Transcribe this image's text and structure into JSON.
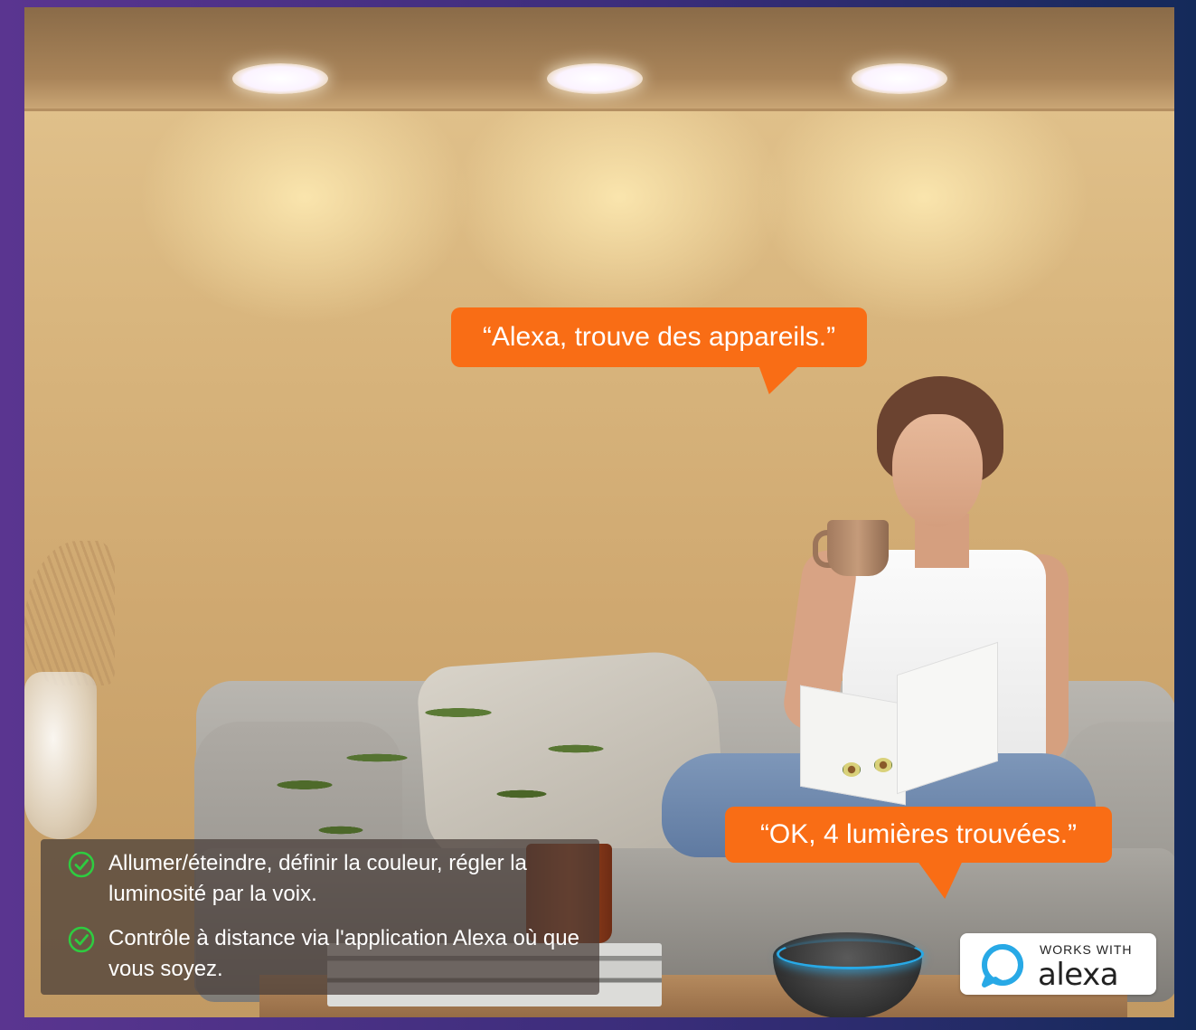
{
  "speech": {
    "request": "“Alexa, trouve des appareils.”",
    "response": "“OK, 4 lumières trouvées.”"
  },
  "features": [
    {
      "icon": "check-circle-icon",
      "text": "Allumer/éteindre, définir la couleur, régler la luminosité par la voix."
    },
    {
      "icon": "check-circle-icon",
      "text": "Contrôle à distance via l'application Alexa où que vous soyez."
    }
  ],
  "badge": {
    "line1": "WORKS WITH",
    "line2": "alexa",
    "icon": "alexa-ring-icon"
  },
  "colors": {
    "bubble": "#f96d15",
    "check": "#2ecc40",
    "alexa_blue": "#28a9e6",
    "frame_left": "#5a3590",
    "frame_right": "#142a5a"
  }
}
